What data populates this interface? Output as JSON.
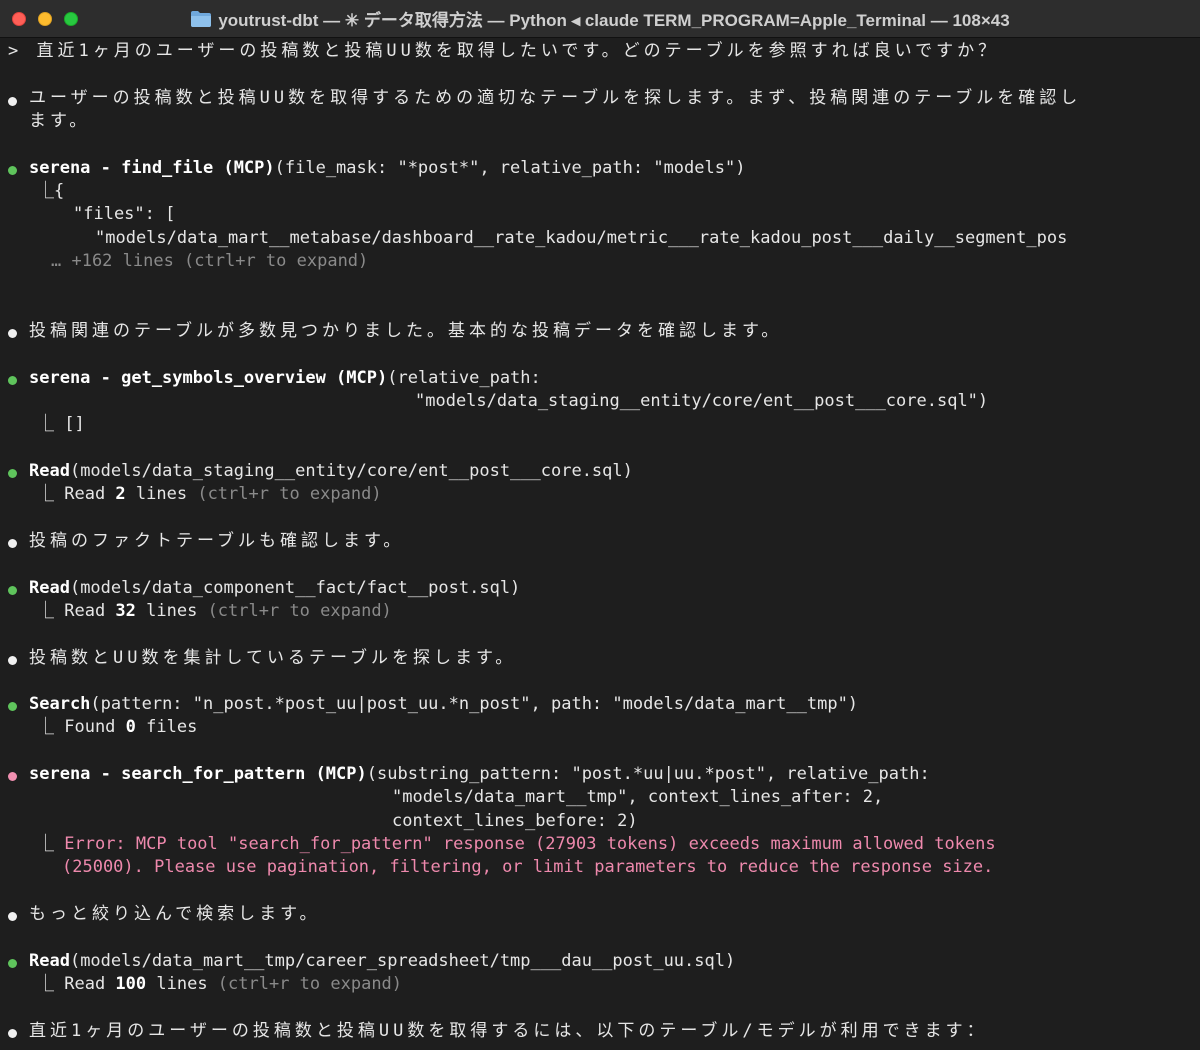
{
  "window": {
    "title": "youtrust-dbt — ✳ データ取得方法 — Python ◂ claude TERM_PROGRAM=Apple_Terminal — 108×43"
  },
  "terminal": {
    "prompt": "> 直近1ヶ月のユーザーの投稿数と投稿UU数を取得したいです。どのテーブルを参照すれば良いですか？",
    "b1": {
      "line1": "ユーザーの投稿数と投稿UU数を取得するための適切なテーブルを探します。まず、投稿関連のテーブルを確認し",
      "line2": "ます。"
    },
    "t1": {
      "name": "serena - find_file (MCP)",
      "args": "(file_mask: \"*post*\", relative_path: \"models\")",
      "r1": "⎿{",
      "r2": "\"files\": [",
      "r3": "\"models/data_mart__metabase/dashboard__rate_kadou/metric___rate_kadou_post___daily__segment_pos",
      "more": "… +162 lines (ctrl+r to expand)"
    },
    "b2": "投稿関連のテーブルが多数見つかりました。基本的な投稿データを確認します。",
    "t2": {
      "name": "serena - get_symbols_overview (MCP)",
      "args1": "(relative_path:",
      "args2": "\"models/data_staging__entity/core/ent__post___core.sql\")",
      "result": "⎿ []"
    },
    "t3": {
      "name": "Read",
      "args": "(models/data_staging__entity/core/ent__post___core.sql)",
      "res_prefix": "⎿ Read ",
      "res_num": "2",
      "res_suffix": " lines",
      "res_hint": " (ctrl+r to expand)"
    },
    "b3": "投稿のファクトテーブルも確認します。",
    "t4": {
      "name": "Read",
      "args": "(models/data_component__fact/fact__post.sql)",
      "res_prefix": "⎿ Read ",
      "res_num": "32",
      "res_suffix": " lines",
      "res_hint": " (ctrl+r to expand)"
    },
    "b4": "投稿数とUU数を集計しているテーブルを探します。",
    "t5": {
      "name": "Search",
      "args": "(pattern: \"n_post.*post_uu|post_uu.*n_post\", path: \"models/data_mart__tmp\")",
      "res_prefix": "⎿ Found ",
      "res_num": "0",
      "res_suffix": " files"
    },
    "t6": {
      "name": "serena - search_for_pattern (MCP)",
      "args1": "(substring_pattern: \"post.*uu|uu.*post\", relative_path:",
      "args2": "\"models/data_mart__tmp\", context_lines_after: 2,",
      "args3": "context_lines_before: 2)",
      "err_prefix": "⎿ ",
      "err1": "Error: MCP tool \"search_for_pattern\" response (27903 tokens) exceeds maximum allowed tokens",
      "err2": "(25000). Please use pagination, filtering, or limit parameters to reduce the response size."
    },
    "b5": "もっと絞り込んで検索します。",
    "t7": {
      "name": "Read",
      "args": "(models/data_mart__tmp/career_spreadsheet/tmp___dau__post_uu.sql)",
      "res_prefix": "⎿ Read ",
      "res_num": "100",
      "res_suffix": " lines",
      "res_hint": " (ctrl+r to expand)"
    },
    "b6": "直近1ヶ月のユーザーの投稿数と投稿UU数を取得するには、以下のテーブル/モデルが利用できます："
  },
  "colors": {
    "background": "#1e1e1e",
    "titlebar": "#2d2d2d",
    "text": "#e6e6e6",
    "success_dot": "#5fc45c",
    "error_dot": "#f08fb0",
    "error_text": "#ee89ad",
    "dim_text": "#8a8a8a"
  }
}
